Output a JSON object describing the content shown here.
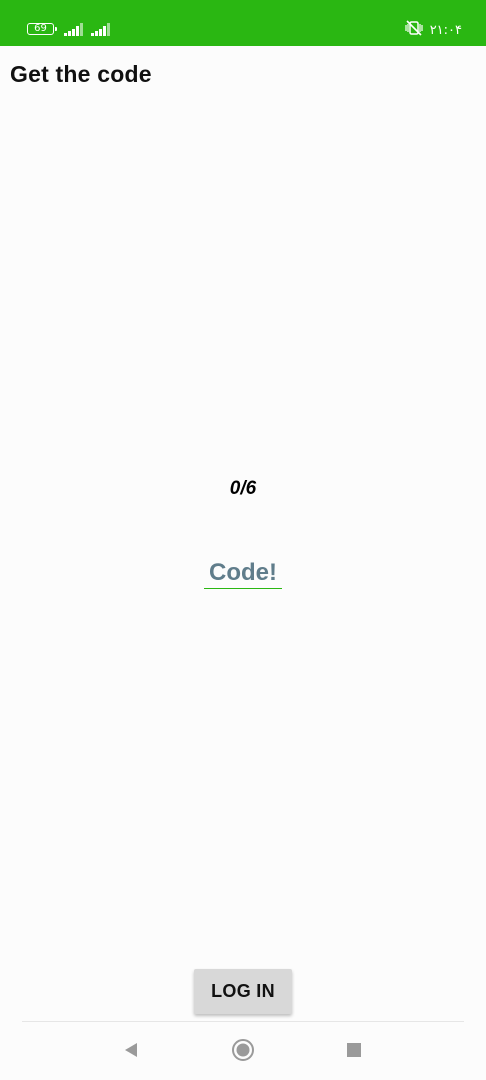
{
  "status_bar": {
    "battery_level": "69",
    "time": "۲۱:۰۴",
    "background_color": "#2ab712",
    "icons": [
      "battery-icon",
      "signal-icon",
      "signal-icon",
      "vibrate-off-icon"
    ]
  },
  "header": {
    "title": "Get the code"
  },
  "main": {
    "counter": "0/6",
    "code_input": {
      "value": "",
      "placeholder": "Code!",
      "underline_color": "#2ab712",
      "text_color": "#607d8b"
    }
  },
  "footer": {
    "login_label": "LOG IN"
  },
  "nav_bar": {
    "buttons": [
      "back-icon",
      "home-icon",
      "recents-icon"
    ]
  }
}
